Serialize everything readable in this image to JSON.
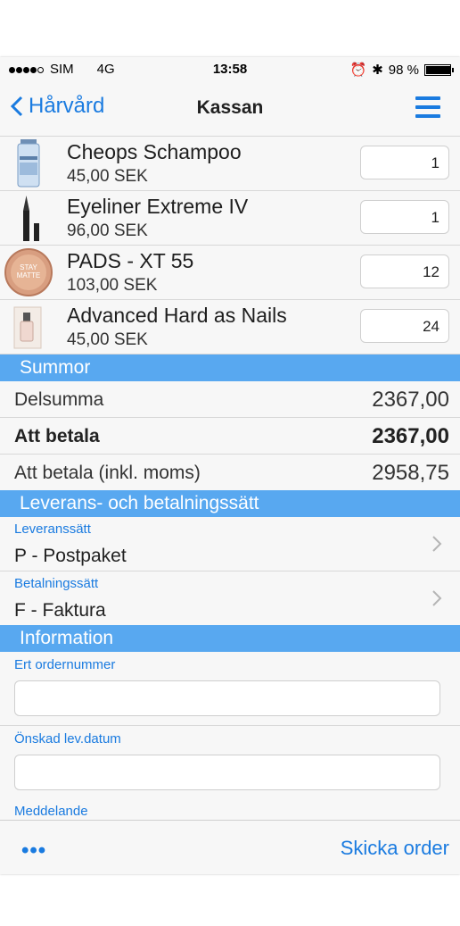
{
  "status": {
    "carrier": "SIM",
    "network": "4G",
    "time": "13:58",
    "battery": "98 %",
    "battery_level": 0.98
  },
  "nav": {
    "back_label": "Hårvård",
    "title": "Kassan"
  },
  "products": [
    {
      "name": "Cheops Schampoo",
      "price": "45,00 SEK",
      "qty": "1",
      "icon": "shampoo-bottle"
    },
    {
      "name": "Eyeliner Extreme IV",
      "price": "96,00 SEK",
      "qty": "1",
      "icon": "eyeliner"
    },
    {
      "name": "PADS - XT 55",
      "price": "103,00 SEK",
      "qty": "12",
      "icon": "powder-compact",
      "icon_text": "STAY MATTE"
    },
    {
      "name": "Advanced Hard as Nails",
      "price": "45,00 SEK",
      "qty": "24",
      "icon": "nail-polish"
    }
  ],
  "summary": {
    "heading": "Summor",
    "rows": [
      {
        "label": "Delsumma",
        "value": "2367,00"
      },
      {
        "label": "Att betala",
        "value": "2367,00"
      },
      {
        "label": "Att betala (inkl. moms)",
        "value": "2958,75"
      }
    ]
  },
  "delivery": {
    "heading": "Leverans- och betalningssätt",
    "shipping_label": "Leveranssätt",
    "shipping_value": "P - Postpaket",
    "payment_label": "Betalningssätt",
    "payment_value": "F - Faktura"
  },
  "information": {
    "heading": "Information",
    "order_number_label": "Ert ordernummer",
    "date_label": "Önskad lev.datum",
    "message_label": "Meddelande"
  },
  "toolbar": {
    "more_label": "•••",
    "send_label": "Skicka order"
  },
  "colors": {
    "accent": "#1a7be0",
    "section": "#58a8f0"
  }
}
